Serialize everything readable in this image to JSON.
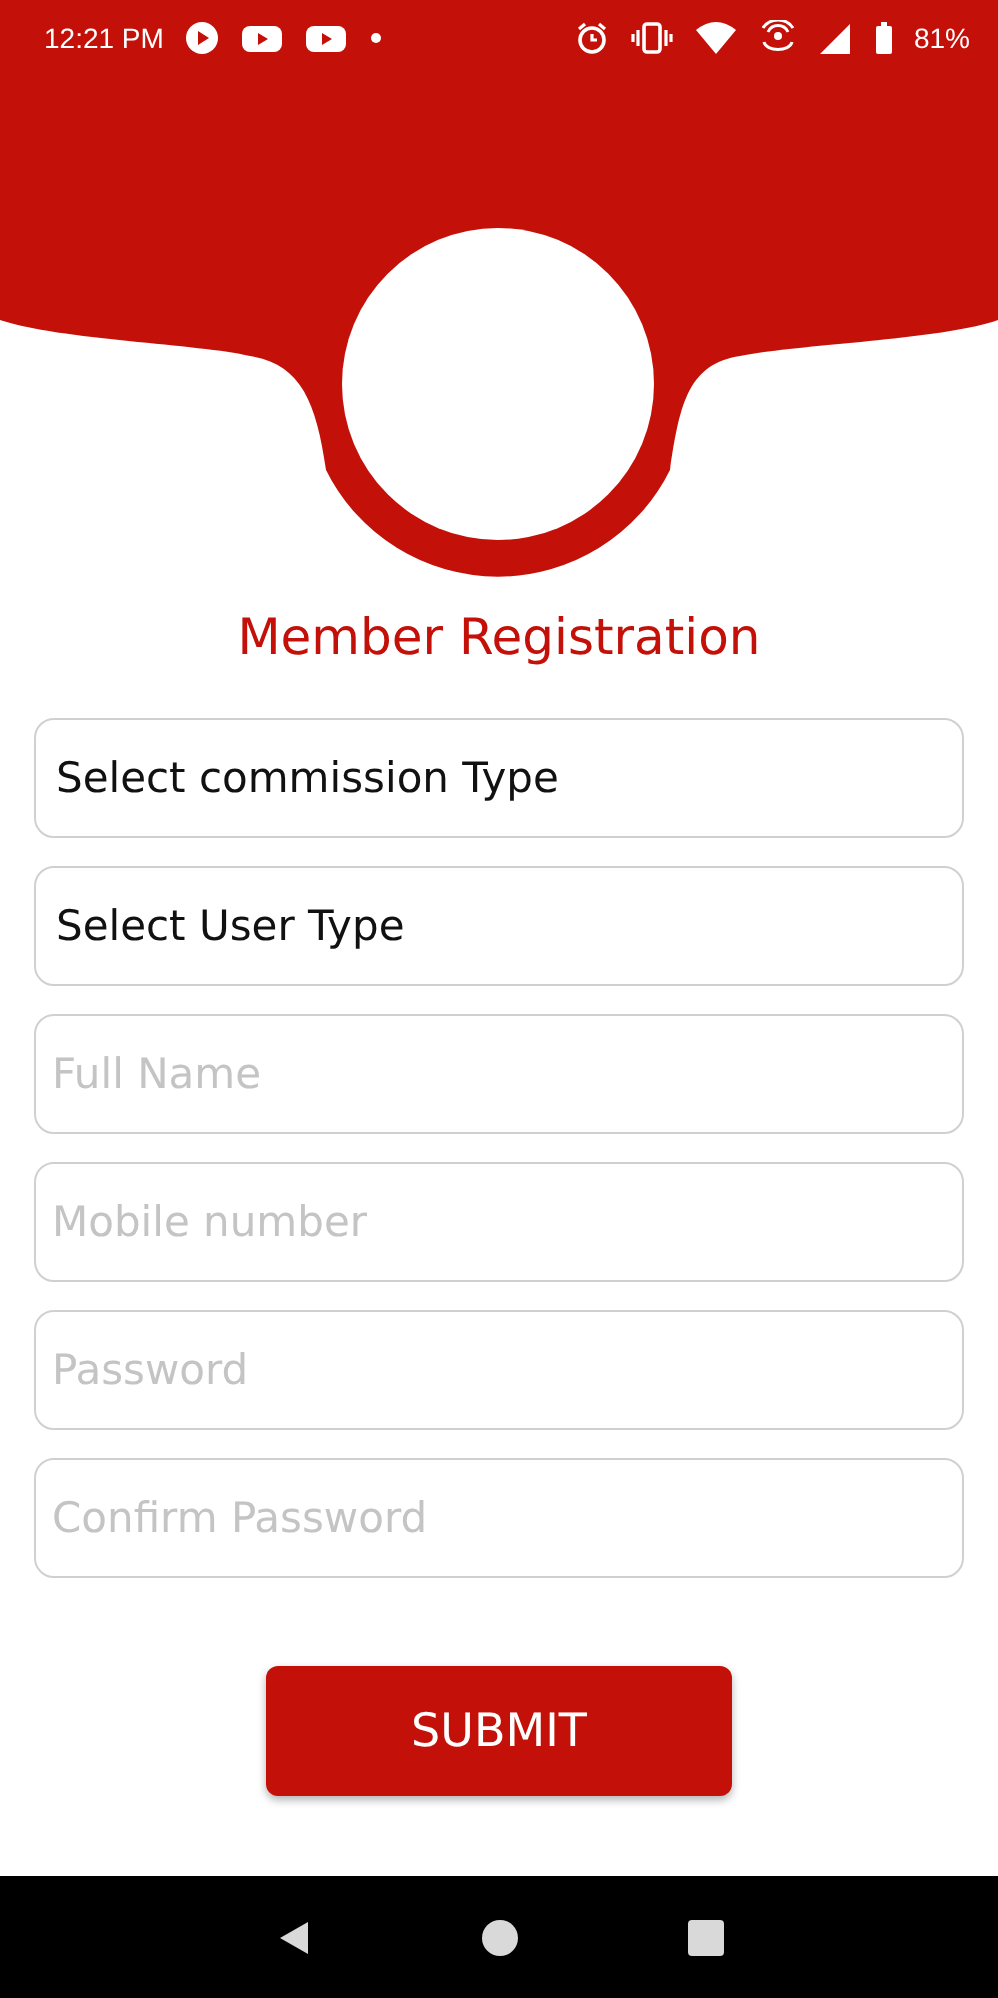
{
  "status_bar": {
    "time": "12:21 PM",
    "battery": "81%"
  },
  "title": "Member Registration",
  "fields": [
    {
      "kind": "select",
      "value": "Select commission Type"
    },
    {
      "kind": "select",
      "value": "Select User Type"
    },
    {
      "kind": "input",
      "placeholder": "Full Name"
    },
    {
      "kind": "input",
      "placeholder": "Mobile number"
    },
    {
      "kind": "input",
      "placeholder": "Password"
    },
    {
      "kind": "input",
      "placeholder": "Confirm Password"
    }
  ],
  "submit": "SUBMIT"
}
